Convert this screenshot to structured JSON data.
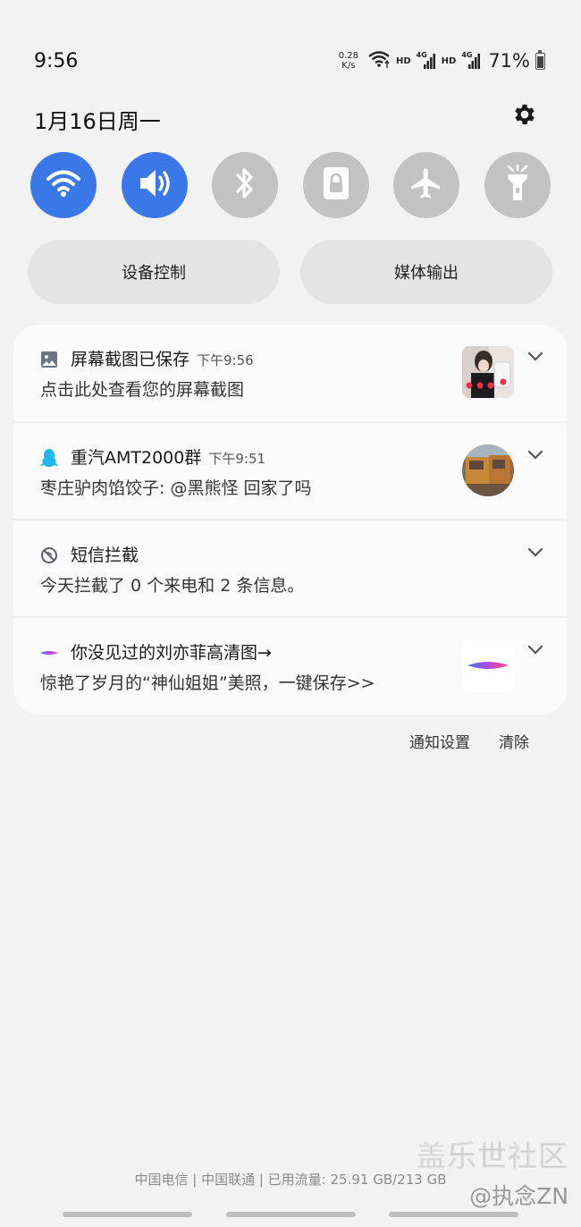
{
  "status_bar": {
    "time": "9:56",
    "net_speed_value": "0.28",
    "net_speed_unit": "K/s",
    "hd_1": "HD",
    "sim1_type": "4G",
    "hd_2": "HD",
    "sim2_type": "4G",
    "battery_percent": "71%",
    "battery_level": 0.71
  },
  "header": {
    "date": "1月16日周一"
  },
  "quick_toggles": [
    {
      "name": "wifi",
      "icon": "wifi-icon",
      "active": true
    },
    {
      "name": "sound",
      "icon": "volume-icon",
      "active": true
    },
    {
      "name": "bluetooth",
      "icon": "bluetooth-icon",
      "active": false
    },
    {
      "name": "screen-lock",
      "icon": "lock-icon",
      "active": false
    },
    {
      "name": "airplane",
      "icon": "airplane-icon",
      "active": false
    },
    {
      "name": "flashlight",
      "icon": "flashlight-icon",
      "active": false
    }
  ],
  "pills": {
    "device_control": "设备控制",
    "media_output": "媒体输出"
  },
  "notifications": [
    {
      "app": "屏幕截图已保存",
      "time": "下午9:56",
      "body": "点击此处查看您的屏幕截图",
      "icon": "image-icon"
    },
    {
      "app": "重汽AMT2000群",
      "time": "下午9:51",
      "body": "枣庄驴肉馅饺子: @黑熊怪 回家了吗",
      "icon": "qq-penguin-icon"
    },
    {
      "app": "短信拦截",
      "time": "",
      "body": "今天拦截了 0 个来电和 2 条信息。",
      "icon": "block-icon"
    },
    {
      "app": "你没见过的刘亦菲高清图→",
      "time": "",
      "body": "惊艳了岁月的“神仙姐姐”美照，一键保存>>",
      "icon": "brush-stroke-icon"
    }
  ],
  "footer": {
    "notification_settings": "通知设置",
    "clear": "清除",
    "carrier_info": "中国电信 | 中国联通 | 已用流量: 25.91 GB/213 GB"
  },
  "watermark": {
    "line1": "盖乐世社区",
    "line2": "@执念ZN"
  },
  "colors": {
    "accent": "#3b78e7",
    "inactive_toggle": "#c2c2c2",
    "background": "#f2f2f2"
  }
}
